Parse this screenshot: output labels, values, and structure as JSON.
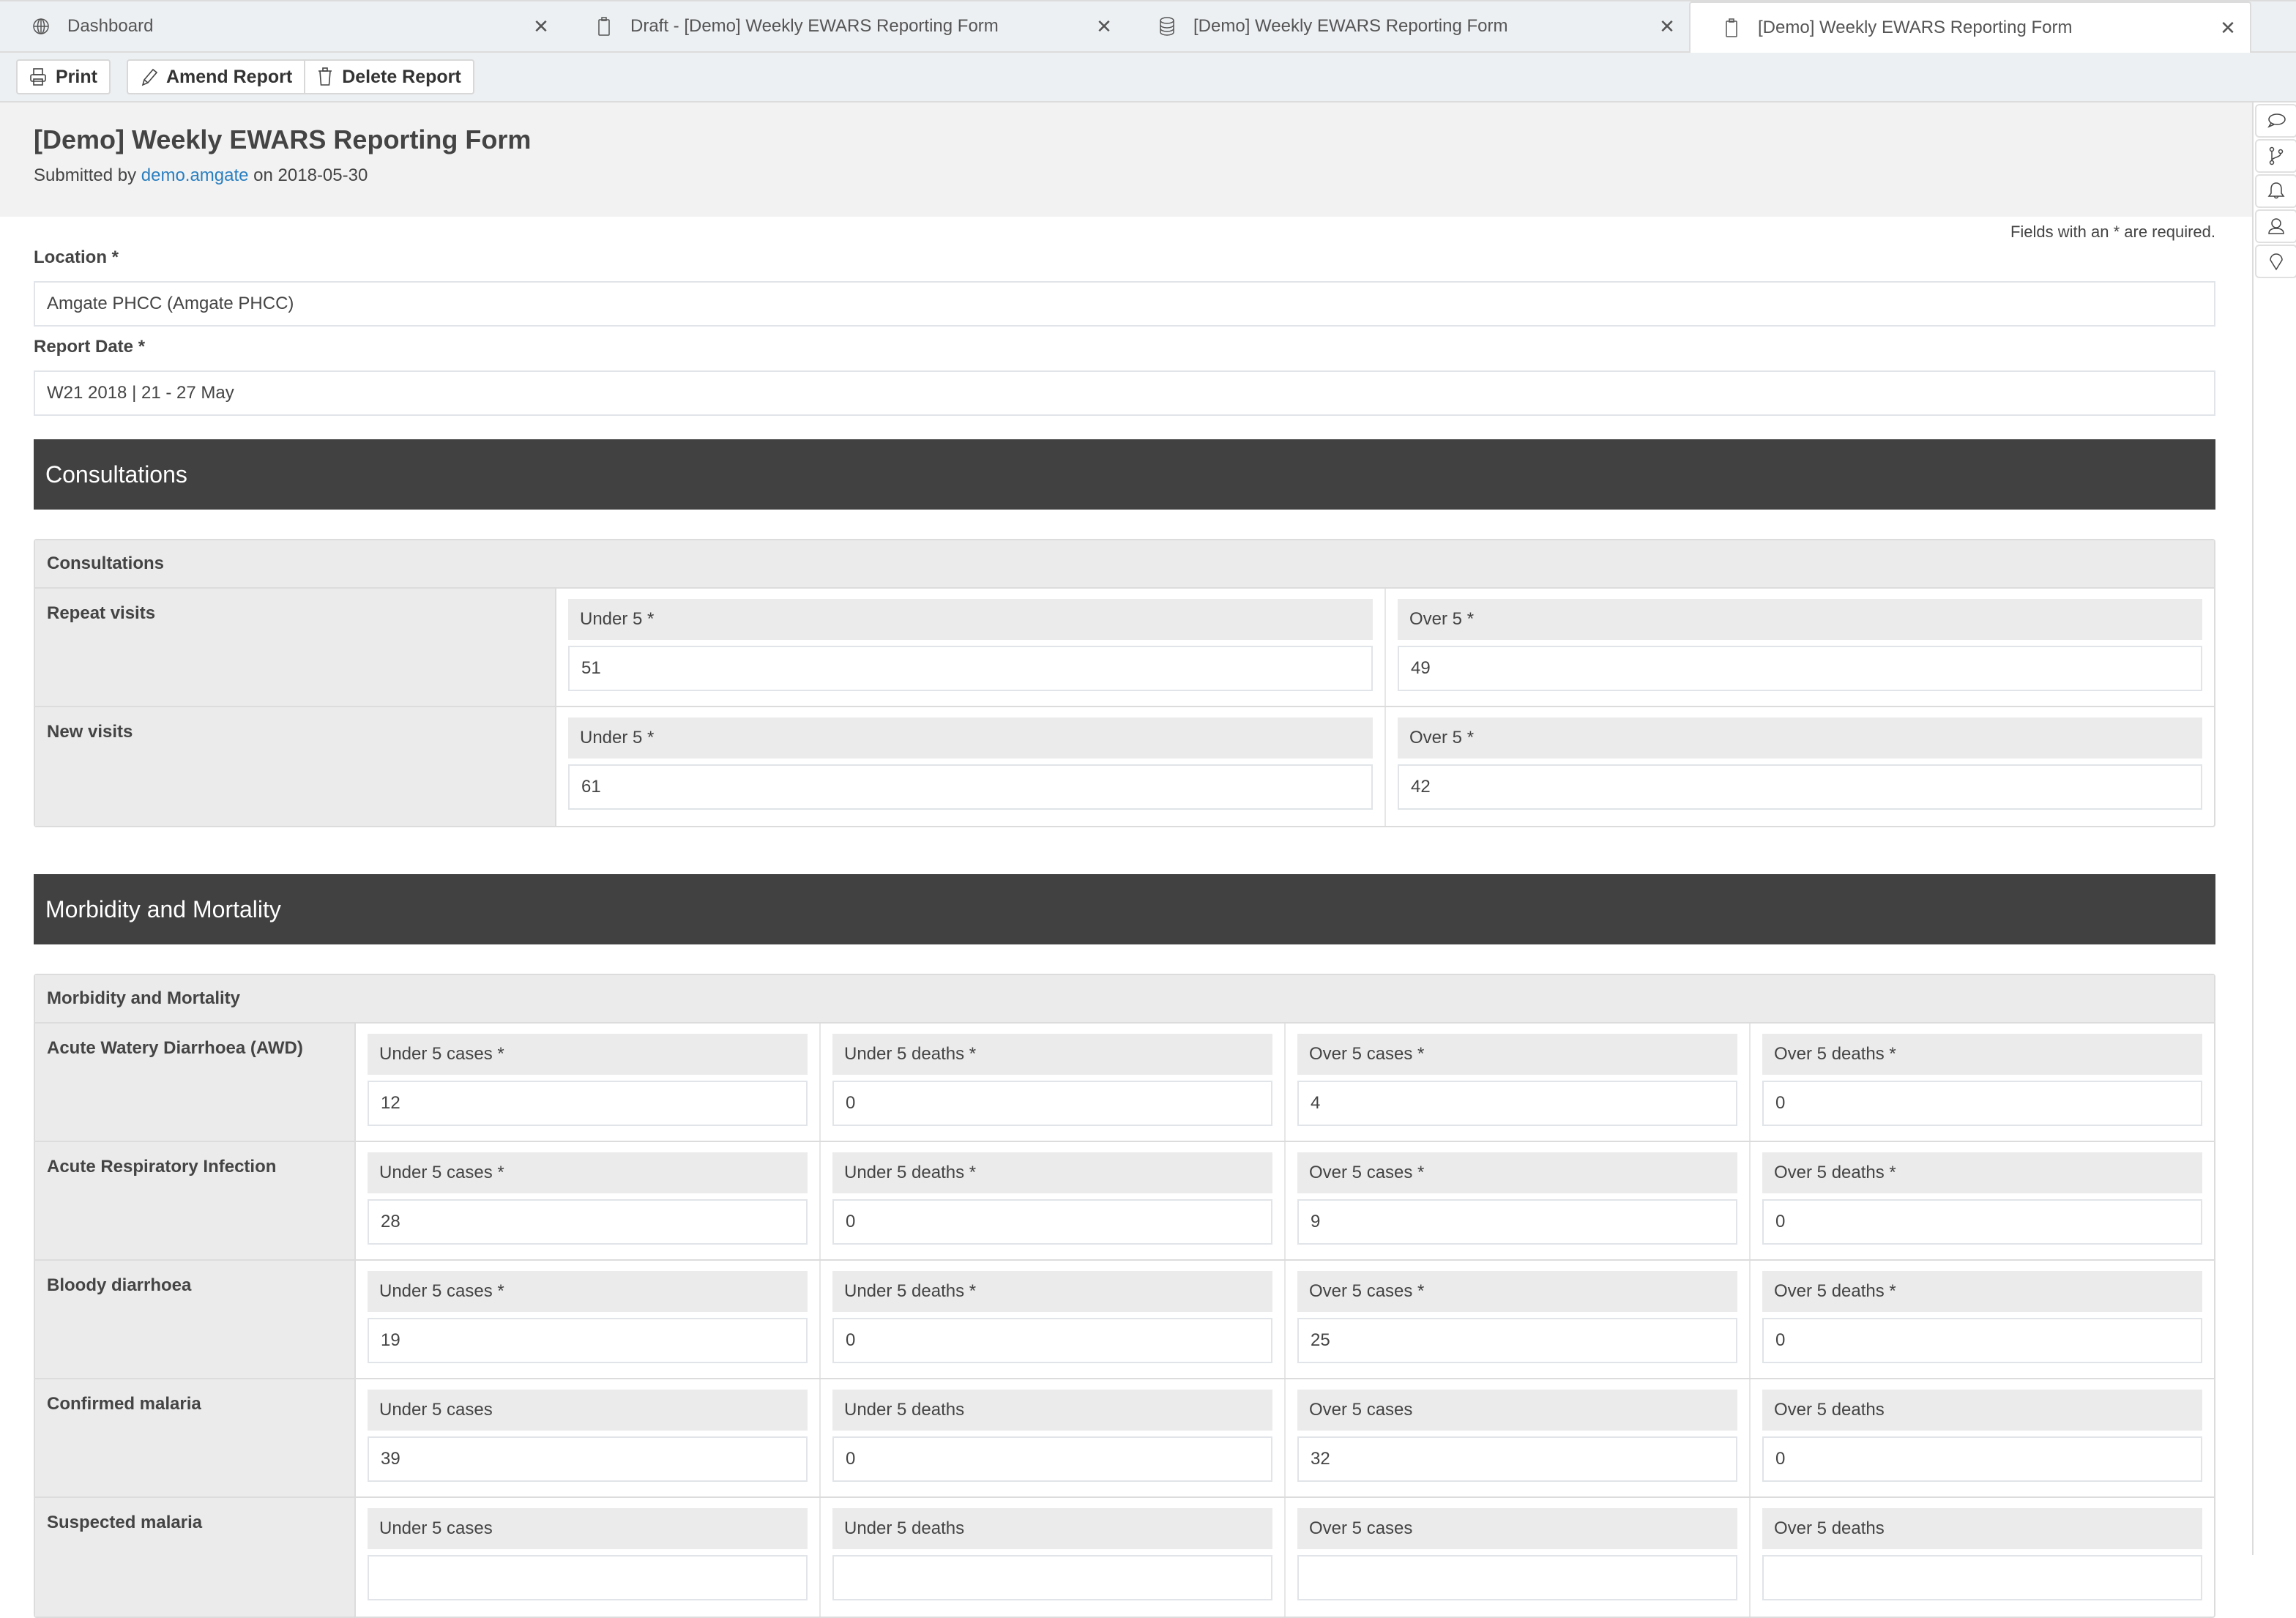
{
  "tabs": [
    {
      "icon": "globe-icon",
      "label": "Dashboard",
      "active": false
    },
    {
      "icon": "clipboard-icon",
      "label": "Draft - [Demo] Weekly EWARS Reporting Form",
      "active": false
    },
    {
      "icon": "database-icon",
      "label": "[Demo] Weekly EWARS Reporting Form",
      "active": false
    },
    {
      "icon": "clipboard-icon",
      "label": "[Demo] Weekly EWARS Reporting Form",
      "active": true
    }
  ],
  "tab_close_glyph": "✕",
  "toolbar": {
    "print_label": "Print",
    "amend_label": "Amend Report",
    "delete_label": "Delete Report"
  },
  "header": {
    "title": "[Demo] Weekly EWARS Reporting Form",
    "submitted_prefix": "Submitted by ",
    "submitted_user": "demo.amgate",
    "submitted_suffix": " on 2018-05-30"
  },
  "right_sidebar": [
    "comment-icon",
    "branch-icon",
    "bell-icon",
    "user-icon",
    "location-pin-icon"
  ],
  "form": {
    "required_note": "Fields with an * are required.",
    "location_label": "Location *",
    "location_value": "Amgate PHCC (Amgate PHCC)",
    "report_date_label": "Report Date *",
    "report_date_value": "W21 2018 | 21 - 27 May"
  },
  "sections": {
    "consultations": {
      "title": "Consultations",
      "panel_title": "Consultations",
      "rows": [
        {
          "label": "Repeat visits",
          "fields": [
            {
              "label": "Under 5 *",
              "value": "51"
            },
            {
              "label": "Over 5 *",
              "value": "49"
            }
          ]
        },
        {
          "label": "New visits",
          "fields": [
            {
              "label": "Under 5 *",
              "value": "61"
            },
            {
              "label": "Over 5 *",
              "value": "42"
            }
          ]
        }
      ]
    },
    "morbidity": {
      "title": "Morbidity and Mortality",
      "panel_title": "Morbidity and Mortality",
      "rows": [
        {
          "label": "Acute Watery Diarrhoea (AWD)",
          "fields": [
            {
              "label": "Under 5 cases *",
              "value": "12"
            },
            {
              "label": "Under 5 deaths *",
              "value": "0"
            },
            {
              "label": "Over 5 cases *",
              "value": "4"
            },
            {
              "label": "Over 5 deaths *",
              "value": "0"
            }
          ]
        },
        {
          "label": "Acute Respiratory Infection",
          "fields": [
            {
              "label": "Under 5 cases *",
              "value": "28"
            },
            {
              "label": "Under 5 deaths *",
              "value": "0"
            },
            {
              "label": "Over 5 cases *",
              "value": "9"
            },
            {
              "label": "Over 5 deaths *",
              "value": "0"
            }
          ]
        },
        {
          "label": "Bloody diarrhoea",
          "fields": [
            {
              "label": "Under 5 cases *",
              "value": "19"
            },
            {
              "label": "Under 5 deaths *",
              "value": "0"
            },
            {
              "label": "Over 5 cases *",
              "value": "25"
            },
            {
              "label": "Over 5 deaths *",
              "value": "0"
            }
          ]
        },
        {
          "label": "Confirmed malaria",
          "fields": [
            {
              "label": "Under 5 cases",
              "value": "39"
            },
            {
              "label": "Under 5 deaths",
              "value": "0"
            },
            {
              "label": "Over 5 cases",
              "value": "32"
            },
            {
              "label": "Over 5 deaths",
              "value": "0"
            }
          ]
        },
        {
          "label": "Suspected malaria",
          "fields": [
            {
              "label": "Under 5 cases",
              "value": ""
            },
            {
              "label": "Under 5 deaths",
              "value": ""
            },
            {
              "label": "Over 5 cases",
              "value": ""
            },
            {
              "label": "Over 5 deaths",
              "value": ""
            }
          ]
        }
      ]
    }
  }
}
